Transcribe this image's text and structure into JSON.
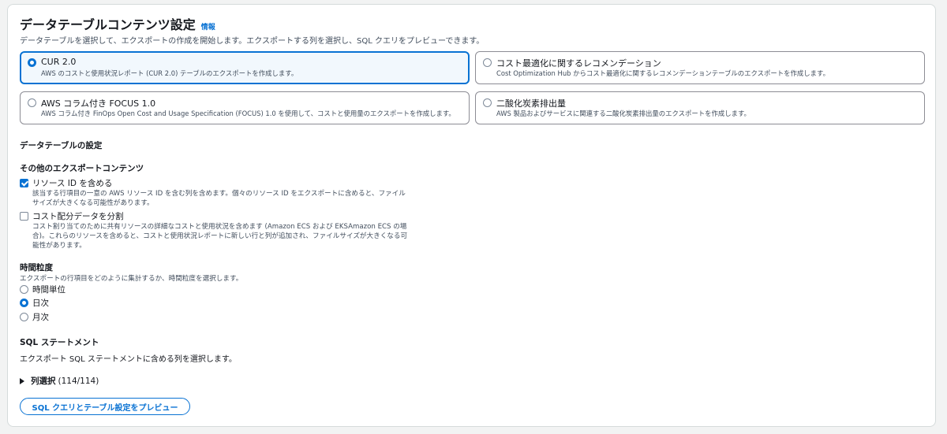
{
  "header": {
    "title": "データテーブルコンテンツ設定",
    "info": "情報",
    "description": "データテーブルを選択して、エクスポートの作成を開始します。エクスポートする列を選択し、SQL クエリをプレビューできます。"
  },
  "tables": [
    {
      "title": "CUR 2.0",
      "desc": "AWS のコストと使用状況レポート (CUR 2.0) テーブルのエクスポートを作成します。",
      "selected": true
    },
    {
      "title": "コスト最適化に関するレコメンデーション",
      "desc": "Cost Optimization Hub からコスト最適化に関するレコメンデーションテーブルのエクスポートを作成します。",
      "selected": false
    },
    {
      "title": "AWS コラム付き FOCUS 1.0",
      "desc": "AWS コラム付き FinOps Open Cost and Usage Specification (FOCUS) 1.0 を使用して、コストと使用量のエクスポートを作成します。",
      "selected": false
    },
    {
      "title": "二酸化炭素排出量",
      "desc": "AWS 製品およびサービスに関連する二酸化炭素排出量のエクスポートを作成します。",
      "selected": false
    }
  ],
  "table_settings": {
    "heading": "データテーブルの設定"
  },
  "additional_content": {
    "heading": "その他のエクスポートコンテンツ",
    "options": [
      {
        "label": "リソース ID を含める",
        "checked": true,
        "desc_lines": [
          "該当する行項目の一意の AWS リソース ID を含む列を含めます。個々のリソース ID をエクスポートに含めると、ファイル",
          "サイズが大きくなる可能性があります。"
        ]
      },
      {
        "label": "コスト配分データを分割",
        "checked": false,
        "desc_lines": [
          "コスト割り当てのために共有リソースの詳細なコストと使用状況を含めます (Amazon ECS および EKSAmazon ECS の場",
          "合)。これらのリソースを含めると、コストと使用状況レポートに新しい行と列が追加され、ファイルサイズが大きくなる可",
          "能性があります。"
        ]
      }
    ]
  },
  "granularity": {
    "heading": "時間粒度",
    "hint": "エクスポートの行項目をどのように集計するか、時間粒度を選択します。",
    "options": [
      {
        "label": "時間単位",
        "selected": false
      },
      {
        "label": "日次",
        "selected": true
      },
      {
        "label": "月次",
        "selected": false
      }
    ]
  },
  "sql": {
    "heading": "SQL ステートメント",
    "desc": "エクスポート SQL ステートメントに含める列を選択します。",
    "expander_label": "列選択",
    "expander_count": "(114/114)",
    "preview_button": "SQL クエリとテーブル設定をプレビュー"
  },
  "colors": {
    "accent": "#0972d3",
    "border": "#8c8c94",
    "text": "#16191f",
    "subtext": "#414d5c"
  }
}
